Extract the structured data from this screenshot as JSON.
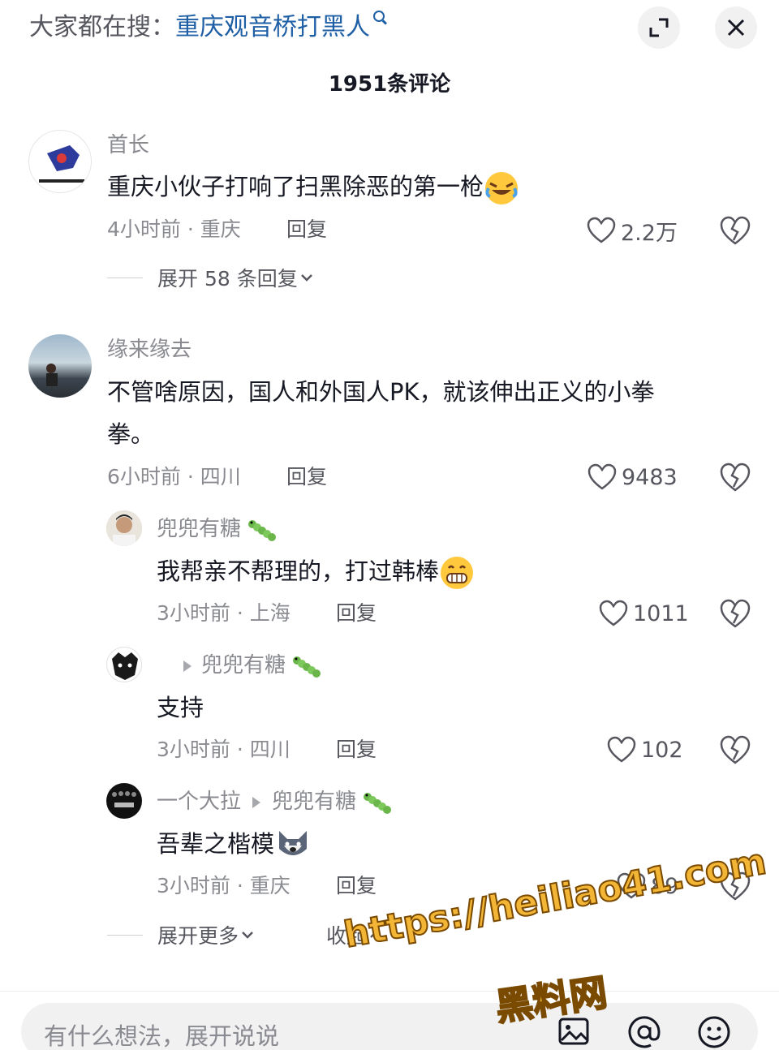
{
  "header": {
    "search_prefix": "大家都在搜：",
    "search_term": "重庆观音桥打黑人"
  },
  "comment_count_title": "1951条评论",
  "comments": [
    {
      "username": "首长",
      "text": "重庆小伙子打响了扫黑除恶的第一枪",
      "time_location": "4小时前 · 重庆",
      "reply_label": "回复",
      "likes": "2.2万",
      "expand_label": "展开 58 条回复"
    },
    {
      "username": "缘来缘去",
      "text_line1": "不管啥原因，国人和外国人PK，就该伸出正义的小拳",
      "text_line2": "拳。",
      "time_location": "6小时前 · 四川",
      "reply_label": "回复",
      "likes": "9483"
    }
  ],
  "replies": [
    {
      "username": "兜兜有糖",
      "text": "我帮亲不帮理的，打过韩棒",
      "time_location": "3小时前 · 上海",
      "reply_label": "回复",
      "likes": "1011"
    },
    {
      "reply_to": "兜兜有糖",
      "text": "支持",
      "time_location": "3小时前 · 四川",
      "reply_label": "回复",
      "likes": "102"
    },
    {
      "username": "一个大拉",
      "reply_to": "兜兜有糖",
      "text": "吾辈之楷模",
      "time_location": "3小时前 · 重庆",
      "reply_label": "回复",
      "likes": "89"
    }
  ],
  "thread_footer": {
    "expand_more": "展开更多",
    "collapse": "收起"
  },
  "input": {
    "placeholder": "有什么想法，展开说说"
  },
  "watermark": {
    "url": "https://heiliao41.com",
    "name": "黑料网"
  },
  "colors": {
    "link": "#1f5fa6",
    "text": "#161823",
    "muted": "#8a8b91"
  }
}
